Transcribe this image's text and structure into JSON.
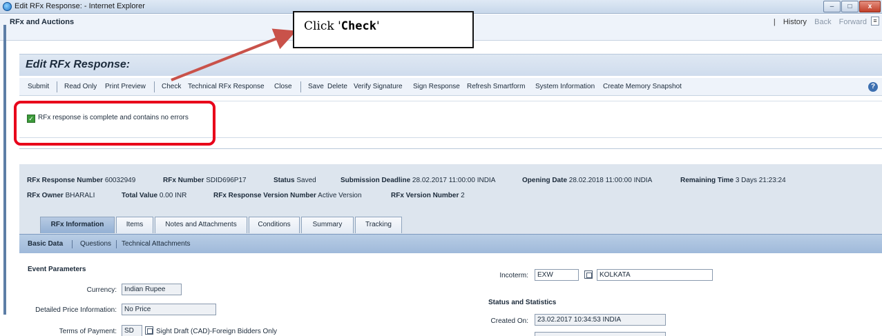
{
  "window": {
    "title": "Edit RFx Response: - Internet Explorer",
    "min_glyph": "–",
    "max_glyph": "□",
    "close_glyph": "x"
  },
  "appbar": {
    "title": "RFx and Auctions",
    "separator": "|",
    "history": "History",
    "back": "Back",
    "forward": "Forward",
    "menu_glyph": "≡"
  },
  "page": {
    "title": "Edit RFx Response:"
  },
  "toolbar": {
    "submit": "Submit",
    "read_only": "Read Only",
    "print_preview": "Print Preview",
    "check": "Check",
    "technical_rfx_response": "Technical RFx Response",
    "close": "Close",
    "save": "Save",
    "delete": "Delete",
    "verify_signature": "Verify Signature",
    "sign_response": "Sign Response",
    "refresh_smartform": "Refresh Smartform",
    "system_information": "System Information",
    "create_memory_snapshot": "Create Memory Snapshot",
    "help_glyph": "?"
  },
  "message": {
    "text": "RFx response is complete and contains no errors",
    "check_glyph": "✓",
    "status_color": "#3c9a3a"
  },
  "header_info": {
    "response_number_label": "RFx Response Number",
    "response_number": "60032949",
    "rfx_number_label": "RFx Number",
    "rfx_number": "SDID696P17",
    "status_label": "Status",
    "status": "Saved",
    "submission_deadline_label": "Submission Deadline",
    "submission_deadline": "28.02.2017 11:00:00 INDIA",
    "opening_date_label": "Opening Date",
    "opening_date": "28.02.2018 11:00:00 INDIA",
    "remaining_time_label": "Remaining Time",
    "remaining_time": "3 Days 21:23:24",
    "owner_label": "RFx Owner",
    "owner": "BHARALI",
    "total_value_label": "Total Value",
    "total_value": "0.00 INR",
    "version_number_label": "RFx Response Version Number",
    "version_number": "Active Version",
    "rfx_version_label": "RFx Version Number",
    "rfx_version": "2"
  },
  "tabs": [
    {
      "label": "RFx Information"
    },
    {
      "label": "Items"
    },
    {
      "label": "Notes and Attachments"
    },
    {
      "label": "Conditions"
    },
    {
      "label": "Summary"
    },
    {
      "label": "Tracking"
    }
  ],
  "subtabs": [
    {
      "label": "Basic Data"
    },
    {
      "label": "Questions"
    },
    {
      "label": "Technical Attachments"
    }
  ],
  "form": {
    "event_parameters_heading": "Event Parameters",
    "currency_label": "Currency:",
    "currency_value": "Indian Rupee",
    "detailed_price_label": "Detailed Price Information:",
    "detailed_price_value": "No Price",
    "terms_label": "Terms of Payment:",
    "terms_code": "SD",
    "terms_text": "Sight Draft (CAD)-Foreign Bidders Only",
    "incoterm_label": "Incoterm:",
    "incoterm_code": "EXW",
    "incoterm_location": "KOLKATA",
    "status_stats_heading": "Status and Statistics",
    "created_on_label": "Created On:",
    "created_on_value": "23.02.2017 10:34:53 INDIA"
  },
  "callout": {
    "prefix": "Click '",
    "emphasis": "Check",
    "suffix": "'",
    "highlight_color": "#e8001b",
    "arrow_color": "#c9524a"
  }
}
